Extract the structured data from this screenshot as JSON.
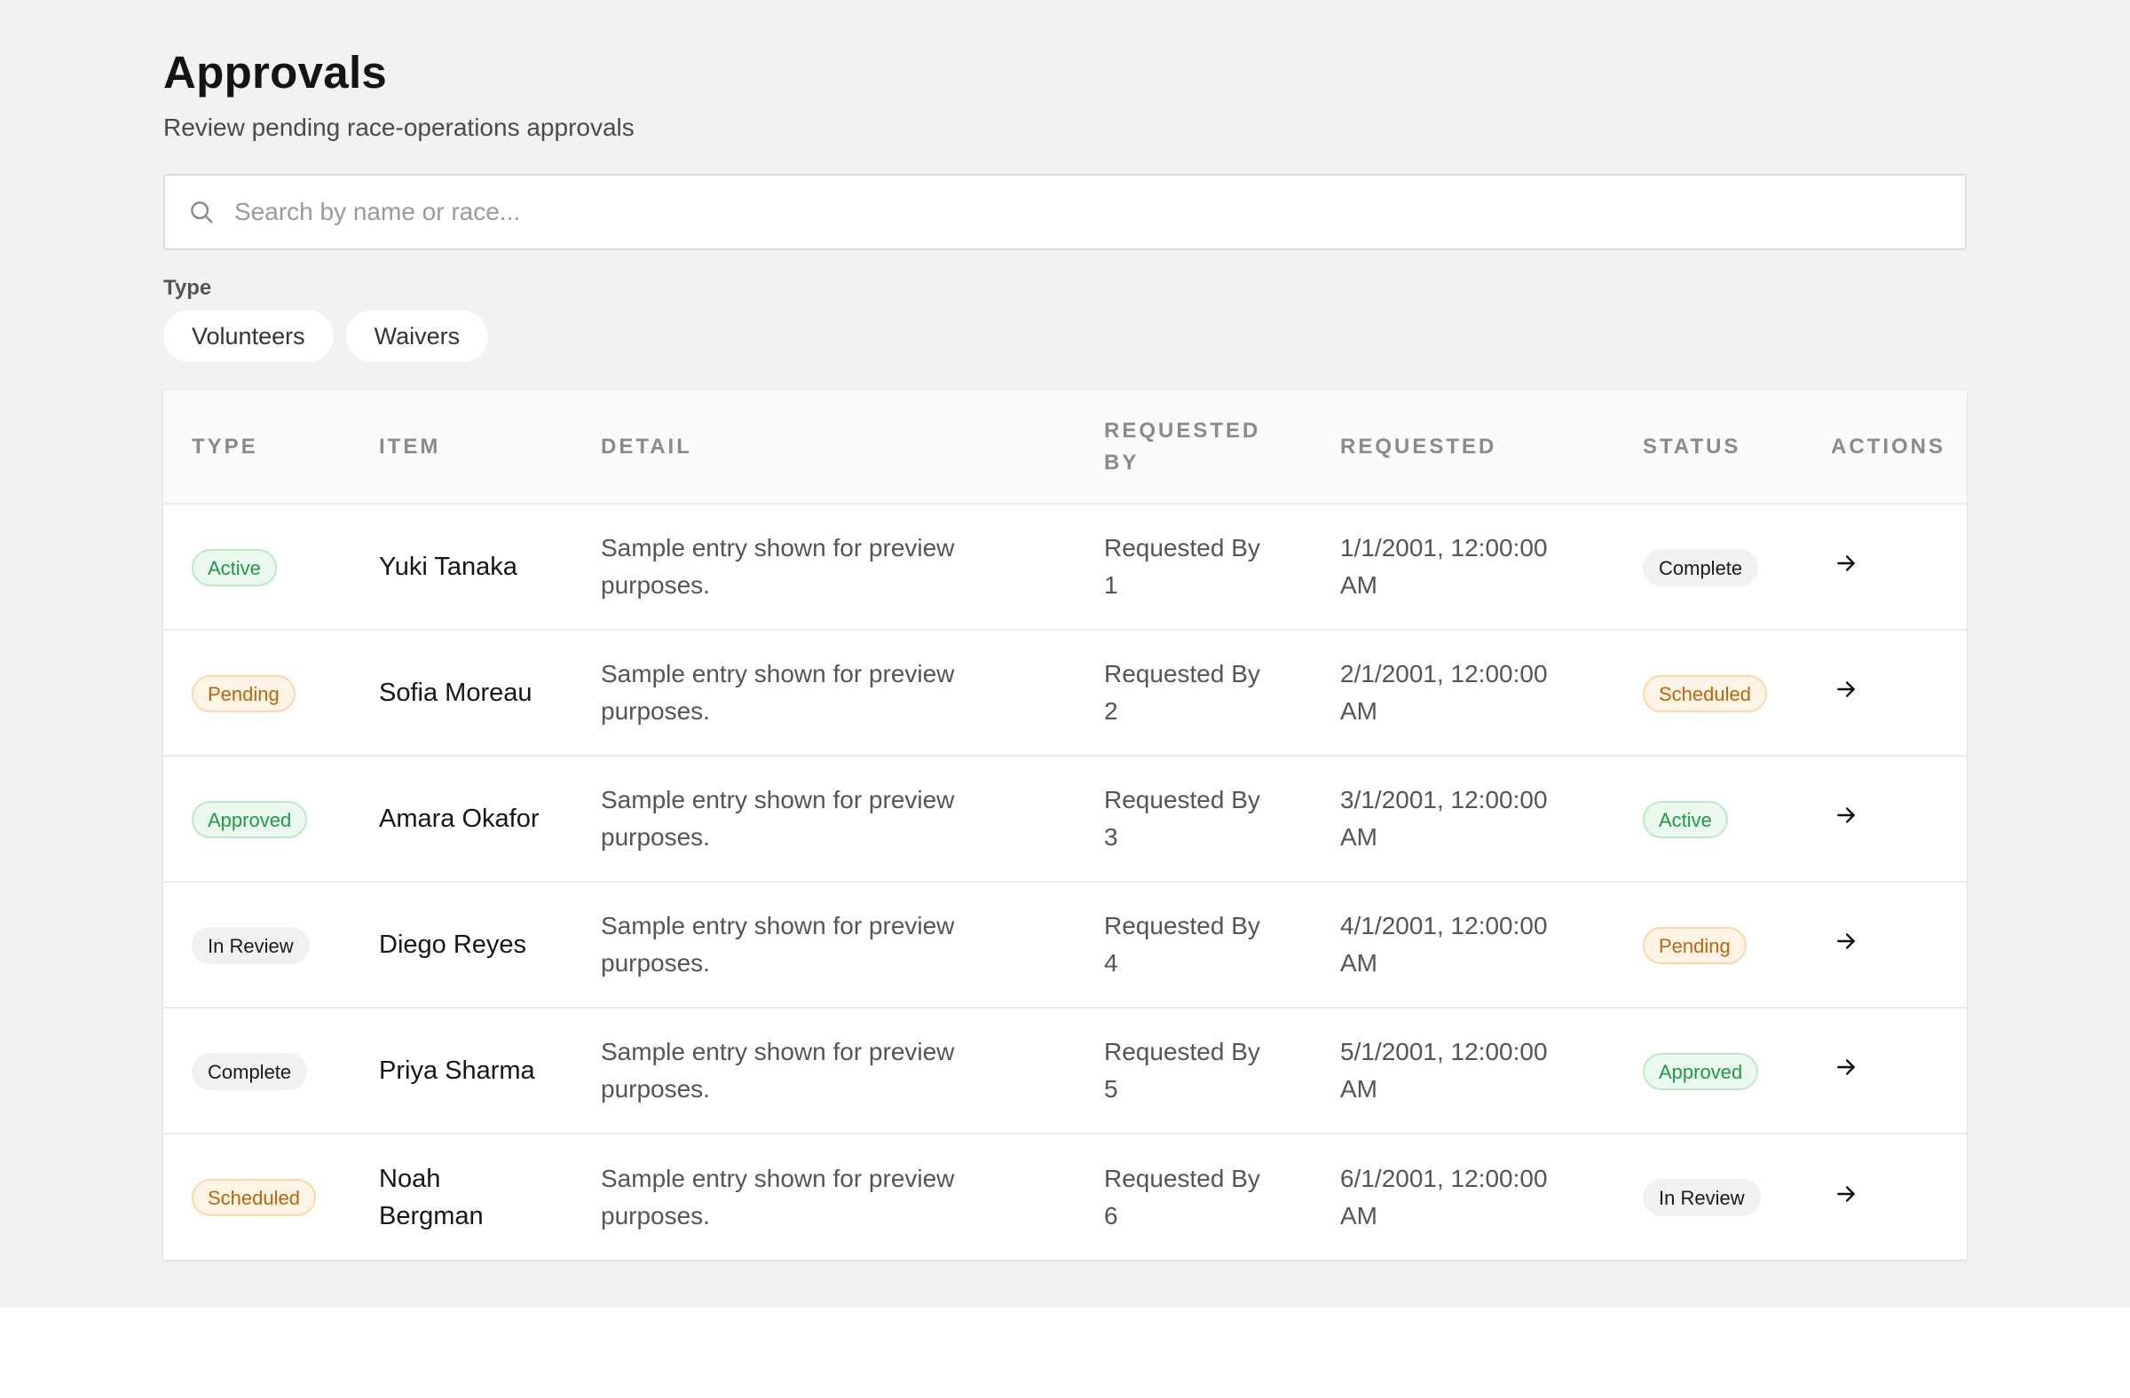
{
  "header": {
    "title": "Approvals",
    "subtitle": "Review pending race-operations approvals"
  },
  "search": {
    "icon": "search-icon",
    "placeholder": "Search by name or race...",
    "value": ""
  },
  "filters": {
    "label": "Type",
    "chips": [
      "Volunteers",
      "Waivers"
    ]
  },
  "table": {
    "columns": [
      "TYPE",
      "ITEM",
      "DETAIL",
      "REQUESTED BY",
      "REQUESTED",
      "STATUS",
      "ACTIONS"
    ],
    "rows": [
      {
        "type": "Active",
        "type_tone": "green",
        "item": "Yuki Tanaka",
        "detail": "Sample entry shown for preview purposes.",
        "requested_by": "Requested By 1",
        "requested": "1/1/2001, 12:00:00 AM",
        "status": "Complete",
        "status_tone": "gray",
        "action_icon": "arrow-right-icon"
      },
      {
        "type": "Pending",
        "type_tone": "orange",
        "item": "Sofia Moreau",
        "detail": "Sample entry shown for preview purposes.",
        "requested_by": "Requested By 2",
        "requested": "2/1/2001, 12:00:00 AM",
        "status": "Scheduled",
        "status_tone": "orange",
        "action_icon": "arrow-right-icon"
      },
      {
        "type": "Approved",
        "type_tone": "green",
        "item": "Amara Okafor",
        "detail": "Sample entry shown for preview purposes.",
        "requested_by": "Requested By 3",
        "requested": "3/1/2001, 12:00:00 AM",
        "status": "Active",
        "status_tone": "green",
        "action_icon": "arrow-right-icon"
      },
      {
        "type": "In Review",
        "type_tone": "gray",
        "item": "Diego Reyes",
        "detail": "Sample entry shown for preview purposes.",
        "requested_by": "Requested By 4",
        "requested": "4/1/2001, 12:00:00 AM",
        "status": "Pending",
        "status_tone": "orange",
        "action_icon": "arrow-right-icon"
      },
      {
        "type": "Complete",
        "type_tone": "gray",
        "item": "Priya Sharma",
        "detail": "Sample entry shown for preview purposes.",
        "requested_by": "Requested By 5",
        "requested": "5/1/2001, 12:00:00 AM",
        "status": "Approved",
        "status_tone": "green",
        "action_icon": "arrow-right-icon"
      },
      {
        "type": "Scheduled",
        "type_tone": "orange",
        "item": "Noah Bergman",
        "detail": "Sample entry shown for preview purposes.",
        "requested_by": "Requested By 6",
        "requested": "6/1/2001, 12:00:00 AM",
        "status": "In Review",
        "status_tone": "gray",
        "action_icon": "arrow-right-icon"
      }
    ]
  },
  "colors": {
    "page_background": "#f2f2f2",
    "badge_green": "#1e9a44",
    "badge_orange": "#c0620a",
    "badge_gray": "#1a1a1a"
  }
}
